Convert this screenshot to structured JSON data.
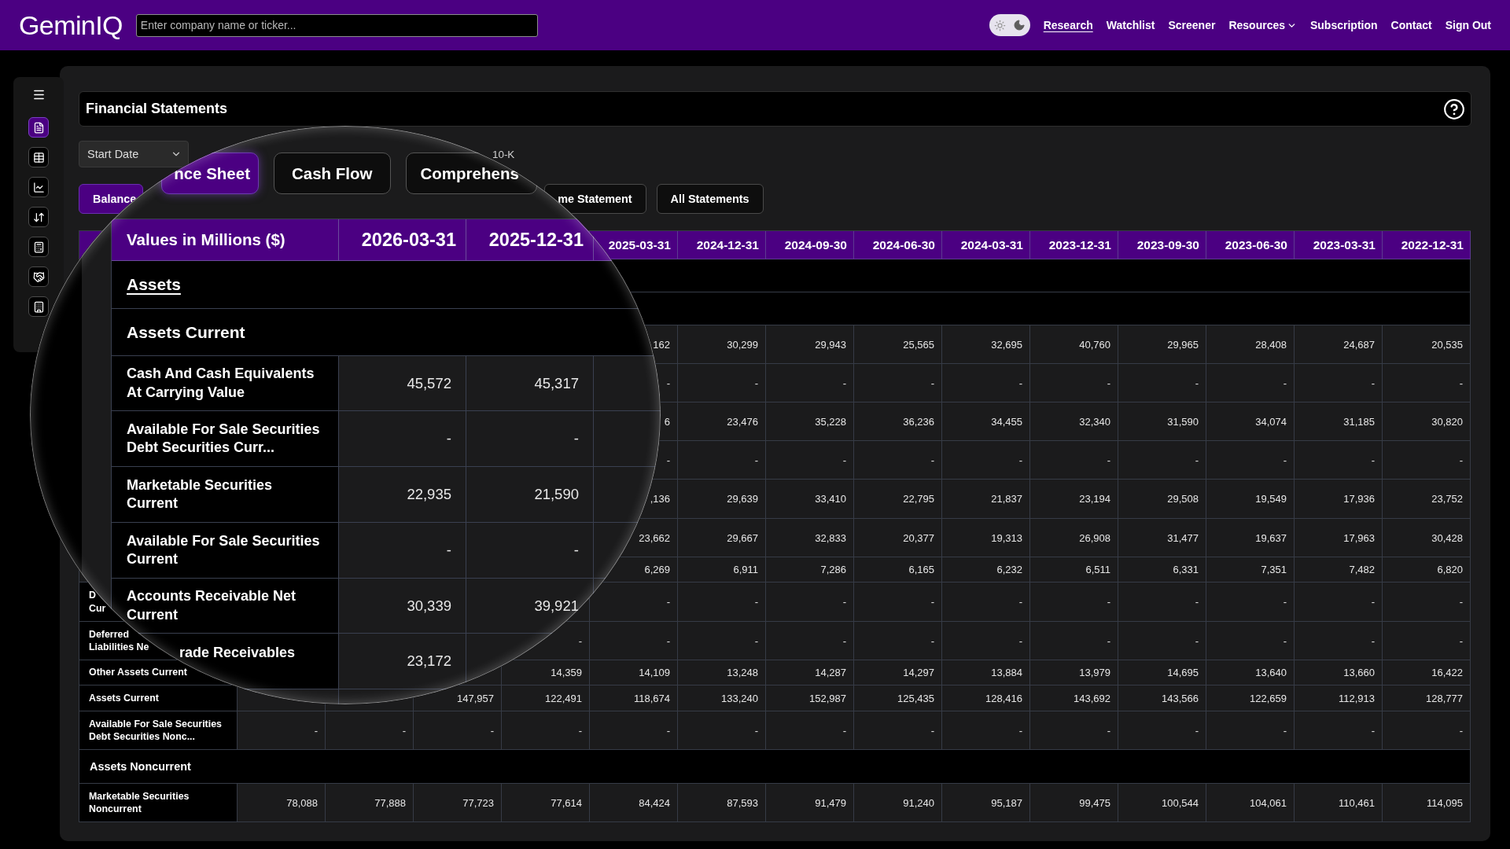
{
  "top_bar": {
    "logo": "GeminIQ",
    "search": {
      "placeholder": "Enter company name or ticker..."
    },
    "theme_toggle": {
      "dark": true
    },
    "nav": [
      {
        "label": "Research",
        "kind": "link",
        "selected": true
      },
      {
        "label": "Watchlist",
        "kind": "link",
        "selected": false
      },
      {
        "label": "Screener",
        "kind": "link",
        "selected": false
      },
      {
        "label": "Resources",
        "kind": "dropdown",
        "selected": false
      },
      {
        "label": "Subscription",
        "kind": "link",
        "selected": false
      },
      {
        "label": "Contact",
        "kind": "link",
        "selected": false
      },
      {
        "label": "Sign Out",
        "kind": "link",
        "selected": false
      }
    ]
  },
  "sidebar": {
    "items": [
      {
        "kind": "menu",
        "selected": false
      },
      {
        "kind": "page",
        "selected": true
      },
      {
        "kind": "page",
        "selected": false
      },
      {
        "kind": "page",
        "selected": false
      },
      {
        "kind": "page",
        "selected": false
      },
      {
        "kind": "page",
        "selected": false
      },
      {
        "kind": "page",
        "selected": false
      },
      {
        "kind": "page",
        "selected": false
      }
    ]
  },
  "panel": {
    "title": "Financial Statements",
    "start_date_select": {
      "label": "Start Date"
    },
    "filing_option": {
      "label": "10-K"
    },
    "statement_buttons": [
      {
        "label": "Balance",
        "selected": true
      },
      {
        "label": "me Statement",
        "selected": false
      },
      {
        "label": "All Statements",
        "selected": false
      }
    ],
    "table": {
      "columns": [
        "2025-03-31",
        "2024-12-31",
        "2024-09-30",
        "2024-06-30",
        "2024-03-31",
        "2023-12-31",
        "2023-09-30",
        "2023-06-30",
        "2023-03-31",
        "2022-12-31"
      ],
      "rows": [
        {
          "kind": "section"
        },
        {
          "kind": "section"
        },
        {
          "kind": "data",
          "cells": [
            "162",
            "30,299",
            "29,943",
            "25,565",
            "32,695",
            "40,760",
            "29,965",
            "28,408",
            "24,687",
            "20,535"
          ]
        },
        {
          "kind": "data",
          "cells": [
            "-",
            "-",
            "-",
            "-",
            "-",
            "-",
            "-",
            "-",
            "-",
            "-"
          ]
        },
        {
          "kind": "data",
          "cells": [
            "6",
            "23,476",
            "35,228",
            "36,236",
            "34,455",
            "32,340",
            "31,590",
            "34,074",
            "31,185",
            "30,820"
          ]
        },
        {
          "kind": "data",
          "cells": [
            "-",
            "-",
            "-",
            "-",
            "-",
            "-",
            "-",
            "-",
            "-",
            "-"
          ]
        },
        {
          "kind": "data",
          "cells": [
            ",136",
            "29,639",
            "33,410",
            "22,795",
            "21,837",
            "23,194",
            "29,508",
            "19,549",
            "17,936",
            "23,752"
          ]
        },
        {
          "kind": "data",
          "cells": [
            "23,662",
            "29,667",
            "32,833",
            "20,377",
            "19,313",
            "26,908",
            "31,477",
            "19,637",
            "17,963",
            "30,428"
          ]
        },
        {
          "kind": "data",
          "cells": [
            "6,269",
            "6,911",
            "7,286",
            "6,165",
            "6,232",
            "6,511",
            "6,331",
            "7,351",
            "7,482",
            "6,820"
          ]
        },
        {
          "kind": "data",
          "label_lines": [
            "D",
            "Cur"
          ],
          "cells": [
            "-",
            "-",
            "-",
            "-",
            "-",
            "-",
            "-",
            "-",
            "-",
            "-"
          ]
        },
        {
          "kind": "data",
          "label_lines": [
            "Deferred",
            "Liabilities Ne"
          ],
          "cells": [
            "-",
            "-",
            "-",
            "-",
            "-",
            "-",
            "-",
            "-",
            "-",
            "-",
            "-"
          ]
        },
        {
          "kind": "data",
          "label_lines": [
            "Other Assets Current"
          ],
          "cells": [
            "14,359",
            "14,109",
            "13,248",
            "14,287",
            "14,297",
            "13,884",
            "13,979",
            "14,695",
            "13,640",
            "13,660",
            "16,422"
          ]
        },
        {
          "kind": "data",
          "label_lines": [
            "Assets Current"
          ],
          "cells": [
            "147,957",
            "122,491",
            "118,674",
            "133,240",
            "152,987",
            "125,435",
            "128,416",
            "143,692",
            "143,566",
            "122,659",
            "112,913",
            "128,777"
          ]
        },
        {
          "kind": "data",
          "label_lines": [
            "Available For Sale Securities",
            "Debt Securities Nonc..."
          ],
          "cells": [
            "-",
            "-",
            "-",
            "-",
            "-",
            "-",
            "-",
            "-",
            "-",
            "-",
            "-",
            "-",
            "-",
            "-"
          ]
        },
        {
          "kind": "section",
          "label": "Assets Noncurrent"
        },
        {
          "kind": "data",
          "label_lines": [
            "Marketable Securities",
            "Noncurrent"
          ],
          "cells": [
            "78,088",
            "77,888",
            "77,723",
            "77,614",
            "84,424",
            "87,593",
            "91,479",
            "91,240",
            "95,187",
            "99,475",
            "100,544",
            "104,061",
            "110,461",
            "114,095"
          ]
        }
      ]
    }
  },
  "magnifier": {
    "buttons": [
      {
        "label": "nce Sheet",
        "selected": true
      },
      {
        "label": "Cash Flow",
        "selected": false
      },
      {
        "label": "Comprehens",
        "selected": false
      }
    ],
    "table": {
      "columns": [
        "Values in Millions ($)",
        "2026-03-31",
        "2025-12-31"
      ],
      "rows": [
        {
          "kind": "heading",
          "label": "Assets"
        },
        {
          "kind": "section",
          "label": "Assets Current"
        },
        {
          "kind": "data",
          "label_lines": [
            "Cash And Cash Equivalents",
            "At Carrying Value"
          ],
          "cells": [
            "45,572",
            "45,317"
          ]
        },
        {
          "kind": "data",
          "label_lines": [
            "Available For Sale Securities",
            "Debt Securities Curr..."
          ],
          "cells": [
            "-",
            "-"
          ]
        },
        {
          "kind": "data",
          "label_lines": [
            "Marketable Securities",
            "Current"
          ],
          "cells": [
            "22,935",
            "21,590"
          ]
        },
        {
          "kind": "data",
          "label_lines": [
            "Available For Sale Securities",
            "Current"
          ],
          "cells": [
            "-",
            "-"
          ]
        },
        {
          "kind": "data",
          "label_lines": [
            "Accounts Receivable Net",
            "Current"
          ],
          "cells": [
            "30,339",
            "39,921"
          ]
        },
        {
          "kind": "data",
          "label_lines": [
            "rade Receivables"
          ],
          "cells": [
            "23,172"
          ]
        }
      ]
    }
  }
}
